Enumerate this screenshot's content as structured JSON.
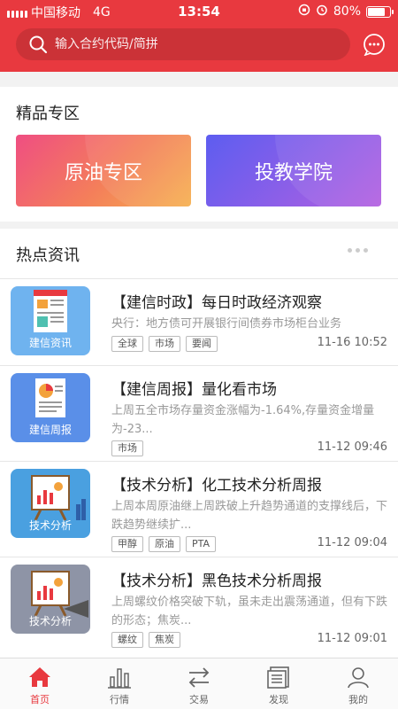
{
  "status_bar": {
    "carrier": "中国移动",
    "network": "4G",
    "time": "13:54",
    "battery": "80%",
    "battery_level": 0.8
  },
  "search": {
    "placeholder": "输入合约代码/简拼"
  },
  "premium": {
    "title": "精品专区",
    "cards": [
      {
        "label": "原油专区"
      },
      {
        "label": "投教学院"
      }
    ]
  },
  "news": {
    "title": "热点资讯",
    "items": [
      {
        "thumb_label": "建信资讯",
        "title": "【建信时政】每日时政经济观察",
        "summary": "央行：地方债可开展银行间债券市场柜台业务",
        "tags": [
          "全球",
          "市场",
          "要闻"
        ],
        "time": "11-16 10:52"
      },
      {
        "thumb_label": "建信周报",
        "title": "【建信周报】量化看市场",
        "summary": "上周五全市场存量资金涨幅为-1.64%,存量资金增量为-23...",
        "tags": [
          "市场"
        ],
        "time": "11-12 09:46"
      },
      {
        "thumb_label": "技术分析",
        "title": "【技术分析】化工技术分析周报",
        "summary": "上周本周原油继上周跌破上升趋势通道的支撑线后，下跌趋势继续扩...",
        "tags": [
          "甲醇",
          "原油",
          "PTA"
        ],
        "time": "11-12 09:04"
      },
      {
        "thumb_label": "技术分析",
        "title": "【技术分析】黑色技术分析周报",
        "summary": "上周螺纹价格突破下轨，虽未走出震荡通道，但有下跌的形态；焦炭...",
        "tags": [
          "螺纹",
          "焦炭"
        ],
        "time": "11-12 09:01"
      }
    ]
  },
  "tabbar": {
    "items": [
      {
        "label": "首页",
        "icon": "home-icon",
        "active": true
      },
      {
        "label": "行情",
        "icon": "bar-chart-icon"
      },
      {
        "label": "交易",
        "icon": "swap-icon"
      },
      {
        "label": "发现",
        "icon": "news-icon"
      },
      {
        "label": "我的",
        "icon": "user-icon"
      }
    ]
  },
  "colors": {
    "accent": "#e8393f",
    "thumb_blue": "#5aa5e6",
    "thumb_gray": "#8e94a6"
  }
}
